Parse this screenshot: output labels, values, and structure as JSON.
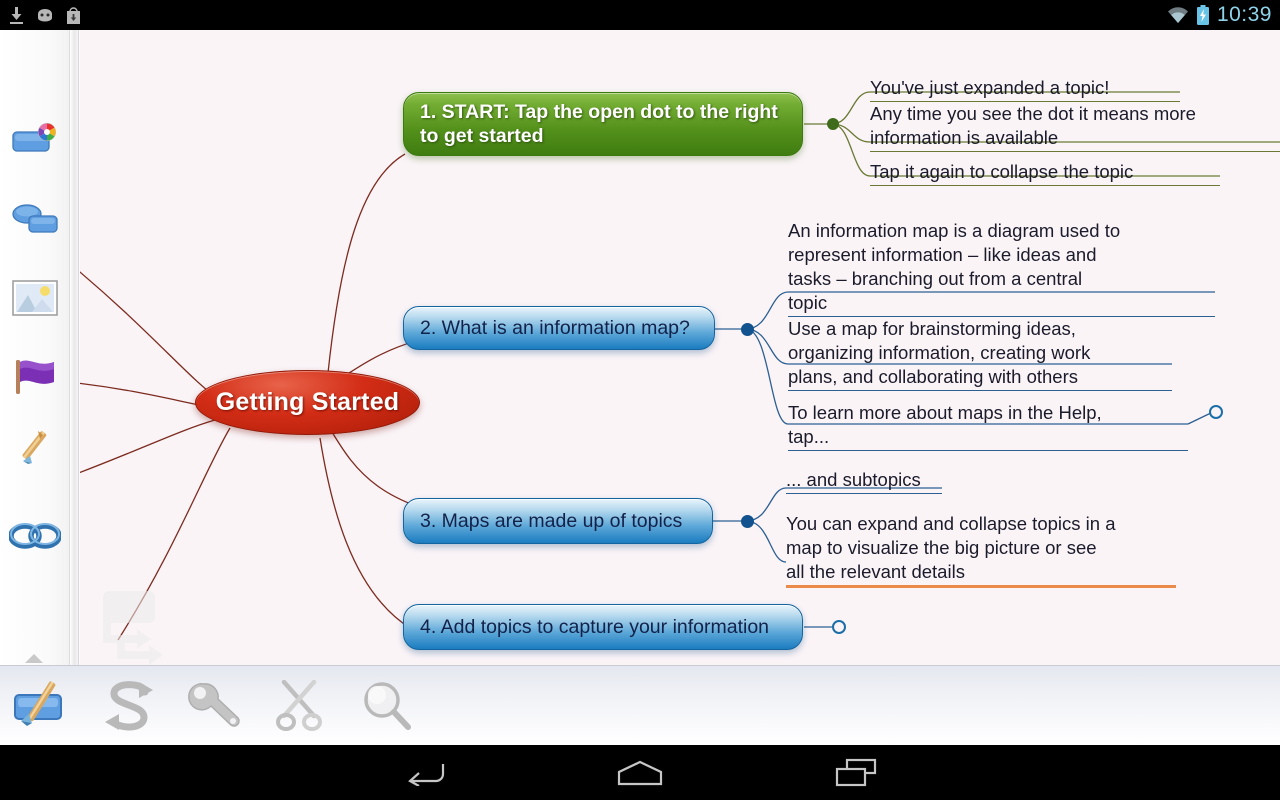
{
  "statusbar": {
    "time": "10:39",
    "left_icons": [
      {
        "name": "download-icon",
        "glyph": "download"
      },
      {
        "name": "android-head-icon",
        "glyph": "android"
      },
      {
        "name": "play-store-download-icon",
        "glyph": "bag"
      }
    ],
    "right_icons": [
      {
        "name": "wifi-icon",
        "glyph": "wifi"
      },
      {
        "name": "battery-charging-icon",
        "glyph": "battery"
      }
    ],
    "accent_color": "#8fd3ea"
  },
  "left_rail": {
    "items": [
      {
        "name": "topic-color-tool",
        "label": "Topic color"
      },
      {
        "name": "topic-shape-tool",
        "label": "Topic shape"
      },
      {
        "name": "image-tool",
        "label": "Image"
      },
      {
        "name": "flag-marker-tool",
        "label": "Flag marker"
      },
      {
        "name": "pen-tool",
        "label": "Pen"
      },
      {
        "name": "link-tool",
        "label": "Link"
      }
    ],
    "more_label": "More"
  },
  "bottom_toolbar": {
    "items": [
      {
        "name": "format-brush-button",
        "label": "Format",
        "active": true
      },
      {
        "name": "undo-redo-button",
        "label": "Undo / Redo",
        "active": false
      },
      {
        "name": "tools-button",
        "label": "Tools",
        "active": false
      },
      {
        "name": "cut-button",
        "label": "Cut",
        "active": false
      },
      {
        "name": "zoom-search-button",
        "label": "Zoom",
        "active": false
      }
    ]
  },
  "navbar": {
    "items": [
      {
        "name": "nav-back-button",
        "label": "Back"
      },
      {
        "name": "nav-home-button",
        "label": "Home"
      },
      {
        "name": "nav-recents-button",
        "label": "Recents"
      }
    ]
  },
  "map": {
    "canvas_background": "#faf4f7",
    "branch_color": "#7d2b1f",
    "central": {
      "label": "Getting Started",
      "fill": "#c8290f",
      "text_color": "#ffffff"
    },
    "topics": [
      {
        "id": "topic-1",
        "label": "1. START: Tap the open dot to the right\nto get started",
        "style": "green",
        "fill": "#5f9c23",
        "dot": "filled-green",
        "dot_color": "#3f6b1c",
        "subtopics": [
          {
            "text": "You've just expanded a topic!",
            "rule": "olive"
          },
          {
            "text": "Any time you see the dot it means more\ninformation is available",
            "rule": "olive"
          },
          {
            "text": "Tap it again to collapse the topic",
            "rule": "olive"
          }
        ]
      },
      {
        "id": "topic-2",
        "label": "2. What is an information map?",
        "style": "blue",
        "fill": "#3d90cc",
        "dot": "filled-blue",
        "dot_color": "#11528f",
        "subtopics": [
          {
            "text": "An information map is a diagram used to\nrepresent information – like ideas and\ntasks – branching out from a central\ntopic",
            "rule": "blue"
          },
          {
            "text": "Use a map for brainstorming ideas,\norganizing information, creating work\nplans, and collaborating with others",
            "rule": "blue"
          },
          {
            "text": "To learn more about maps in the Help,\ntap...",
            "rule": "blue",
            "trailing_dot": "open-blue"
          }
        ]
      },
      {
        "id": "topic-3",
        "label": "3. Maps are made up of topics",
        "style": "blue",
        "fill": "#3d90cc",
        "dot": "filled-blue",
        "dot_color": "#11528f",
        "subtopics": [
          {
            "text": "... and subtopics",
            "rule": "blue"
          },
          {
            "text": "You can expand and collapse topics in a\nmap to visualize the big picture or see\nall the relevant details",
            "rule": "orange"
          }
        ]
      },
      {
        "id": "topic-4",
        "label": "4. Add topics to capture your information",
        "style": "blue",
        "fill": "#3d90cc",
        "dot": "open-blue",
        "dot_color": "#1b6ea8",
        "subtopics": []
      }
    ],
    "ghost_hint": {
      "name": "add-subtopic-ghost-icon"
    }
  }
}
